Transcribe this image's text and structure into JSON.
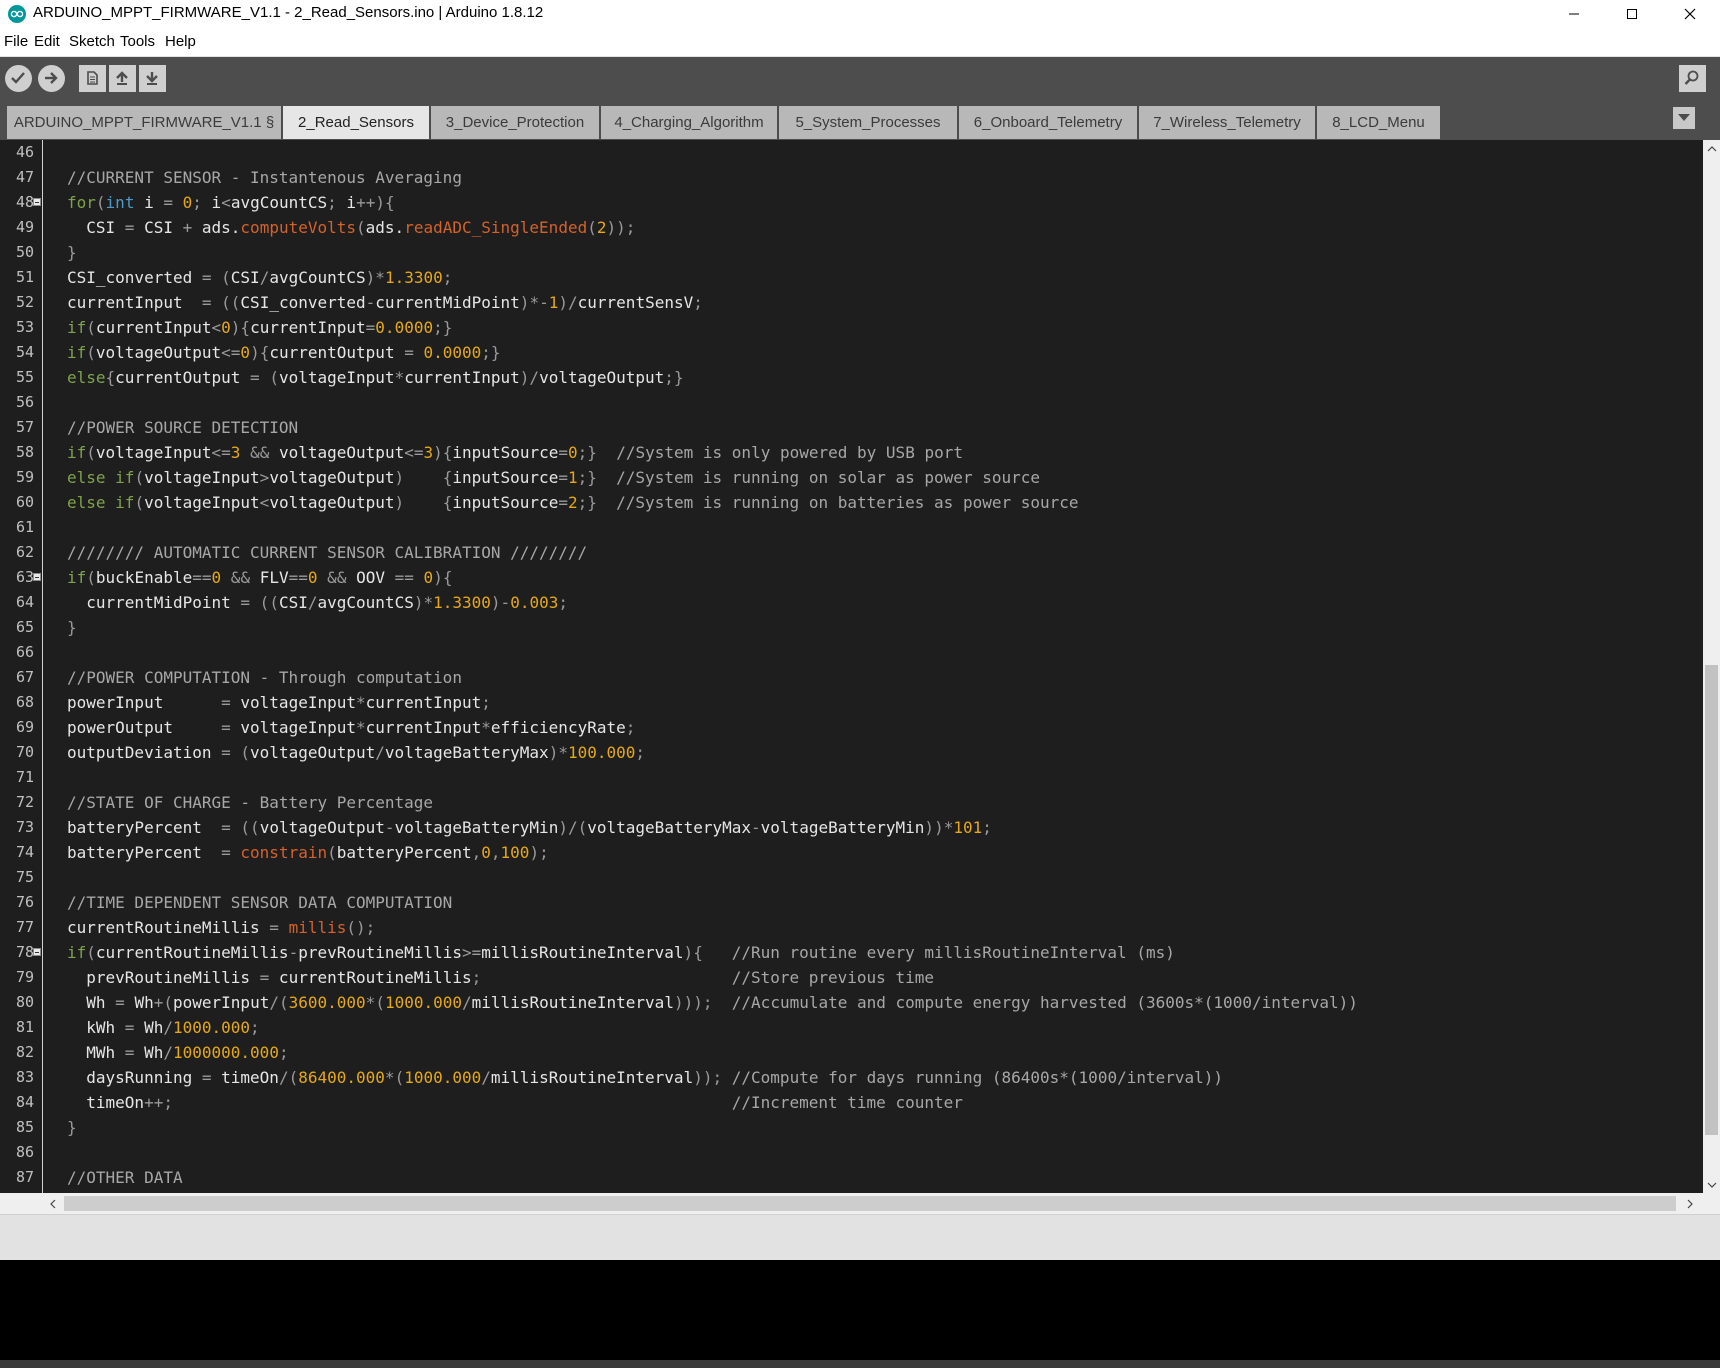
{
  "window": {
    "title": "ARDUINO_MPPT_FIRMWARE_V1.1 - 2_Read_Sensors.ino | Arduino 1.8.12",
    "logo_icon": "arduino-infinity-logo",
    "accent": "#00979c"
  },
  "menu": [
    "File",
    "Edit",
    "Sketch",
    "Tools",
    "Help"
  ],
  "toolbar": {
    "buttons": [
      {
        "name": "verify",
        "icon": "check-icon"
      },
      {
        "name": "upload",
        "icon": "arrow-right-icon"
      },
      {
        "name": "new",
        "icon": "new-file-icon"
      },
      {
        "name": "open",
        "icon": "arrow-up-icon"
      },
      {
        "name": "save",
        "icon": "arrow-down-icon"
      }
    ],
    "serial_monitor_icon": "magnifier-icon"
  },
  "tabs": [
    "ARDUINO_MPPT_FIRMWARE_V1.1 §",
    "2_Read_Sensors",
    "3_Device_Protection",
    "4_Charging_Algorithm",
    "5_System_Processes",
    "6_Onboard_Telemetry",
    "7_Wireless_Telemetry",
    "8_LCD_Menu"
  ],
  "active_tab": "2_Read_Sensors",
  "colors": {
    "keyword": "#7fa34c",
    "type": "#4e9bc7",
    "function": "#d4622a",
    "number": "#e6a817",
    "comment": "#a7a7a7",
    "text": "#e6e6e6",
    "operator": "#9a9a9a"
  },
  "editor": {
    "line_numbers": [
      "46",
      "47",
      "48",
      "49",
      "50",
      "51",
      "52",
      "53",
      "54",
      "55",
      "56",
      "57",
      "58",
      "59",
      "60",
      "61",
      "62",
      "63",
      "64",
      "65",
      "66",
      "67",
      "68",
      "69",
      "70",
      "71",
      "72",
      "73",
      "74",
      "75",
      "76",
      "77",
      "78",
      "79",
      "80",
      "81",
      "82",
      "83",
      "84",
      "85",
      "86",
      "87"
    ],
    "fold_markers_on": [
      "48",
      "63",
      "78"
    ],
    "lines": [
      "",
      "//CURRENT SENSOR - Instantenous Averaging",
      "for(int i = 0; i<avgCountCS; i++){",
      "  CSI = CSI + ads.computeVolts(ads.readADC_SingleEnded(2));",
      "}",
      "CSI_converted = (CSI/avgCountCS)*1.3300;",
      "currentInput  = ((CSI_converted-currentMidPoint)*-1)/currentSensV;",
      "if(currentInput<0){currentInput=0.0000;}",
      "if(voltageOutput<=0){currentOutput = 0.0000;}",
      "else{currentOutput = (voltageInput*currentInput)/voltageOutput;}",
      "",
      "//POWER SOURCE DETECTION",
      "if(voltageInput<=3 && voltageOutput<=3){inputSource=0;}  //System is only powered by USB port",
      "else if(voltageInput>voltageOutput)    {inputSource=1;}  //System is running on solar as power source",
      "else if(voltageInput<voltageOutput)    {inputSource=2;}  //System is running on batteries as power source",
      "",
      "//////// AUTOMATIC CURRENT SENSOR CALIBRATION ////////",
      "if(buckEnable==0 && FLV==0 && OOV == 0){",
      "  currentMidPoint = ((CSI/avgCountCS)*1.3300)-0.003;",
      "}",
      "",
      "//POWER COMPUTATION - Through computation",
      "powerInput      = voltageInput*currentInput;",
      "powerOutput     = voltageInput*currentInput*efficiencyRate;",
      "outputDeviation = (voltageOutput/voltageBatteryMax)*100.000;",
      "",
      "//STATE OF CHARGE - Battery Percentage",
      "batteryPercent  = ((voltageOutput-voltageBatteryMin)/(voltageBatteryMax-voltageBatteryMin))*101;",
      "batteryPercent  = constrain(batteryPercent,0,100);",
      "",
      "//TIME DEPENDENT SENSOR DATA COMPUTATION",
      "currentRoutineMillis = millis();",
      "if(currentRoutineMillis-prevRoutineMillis>=millisRoutineInterval){   //Run routine every millisRoutineInterval (ms)",
      "  prevRoutineMillis = currentRoutineMillis;                          //Store previous time",
      "  Wh = Wh+(powerInput/(3600.000*(1000.000/millisRoutineInterval)));  //Accumulate and compute energy harvested (3600s*(1000/interval))",
      "  kWh = Wh/1000.000;",
      "  MWh = Wh/1000000.000;",
      "  daysRunning = timeOn/(86400.000*(1000.000/millisRoutineInterval)); //Compute for days running (86400s*(1000/interval))",
      "  timeOn++;                                                          //Increment time counter",
      "}",
      "",
      "//OTHER DATA"
    ]
  }
}
